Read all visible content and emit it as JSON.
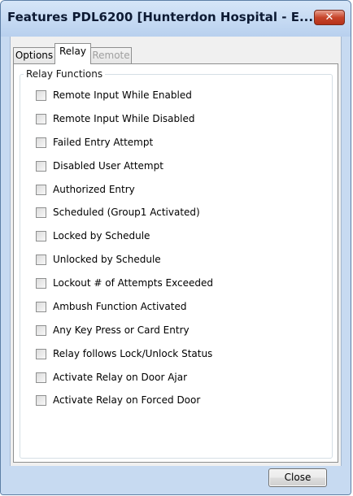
{
  "window": {
    "title": "Features PDL6200 [Hunterdon Hospital - E...",
    "close_glyph": "✕"
  },
  "tabs": [
    {
      "label": "Options",
      "state": "normal"
    },
    {
      "label": "Relay",
      "state": "selected"
    },
    {
      "label": "Remote",
      "state": "disabled"
    }
  ],
  "relay_group": {
    "title": "Relay Functions",
    "items": [
      {
        "label": "Remote Input While Enabled",
        "checked": false
      },
      {
        "label": "Remote Input While Disabled",
        "checked": false
      },
      {
        "label": "Failed Entry Attempt",
        "checked": false
      },
      {
        "label": "Disabled User Attempt",
        "checked": false
      },
      {
        "label": "Authorized Entry",
        "checked": false
      },
      {
        "label": "Scheduled (Group1 Activated)",
        "checked": false
      },
      {
        "label": "Locked by Schedule",
        "checked": false
      },
      {
        "label": "Unlocked by Schedule",
        "checked": false
      },
      {
        "label": "Lockout # of Attempts Exceeded",
        "checked": false
      },
      {
        "label": "Ambush Function Activated",
        "checked": false
      },
      {
        "label": "Any Key Press or Card Entry",
        "checked": false
      },
      {
        "label": "Relay follows Lock/Unlock Status",
        "checked": false
      },
      {
        "label": "Activate Relay on Door Ajar",
        "checked": false
      },
      {
        "label": "Activate Relay on Forced Door",
        "checked": false
      }
    ]
  },
  "footer": {
    "close_label": "Close"
  },
  "colors": {
    "frame": "#c7daf1",
    "titlebar_close": "#c7452b",
    "tab_border": "#8e8f8f"
  }
}
